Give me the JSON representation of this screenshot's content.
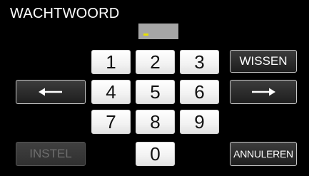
{
  "header": {
    "title": "WACHTWOORD"
  },
  "password_field": {
    "value": ""
  },
  "keypad": {
    "keys": [
      "1",
      "2",
      "3",
      "4",
      "5",
      "6",
      "7",
      "8",
      "9",
      "0"
    ]
  },
  "buttons": {
    "clear_label": "WISSEN",
    "set_label": "INSTEL",
    "cancel_label": "ANNULEREN",
    "left_arrow_icon": "arrow-left-icon",
    "right_arrow_icon": "arrow-right-icon"
  },
  "colors": {
    "background": "#000000",
    "key_light": "#ffffff",
    "key_dark": "#1e1e1e",
    "cursor": "#e8e000",
    "password_field": "#a6a6a6"
  }
}
